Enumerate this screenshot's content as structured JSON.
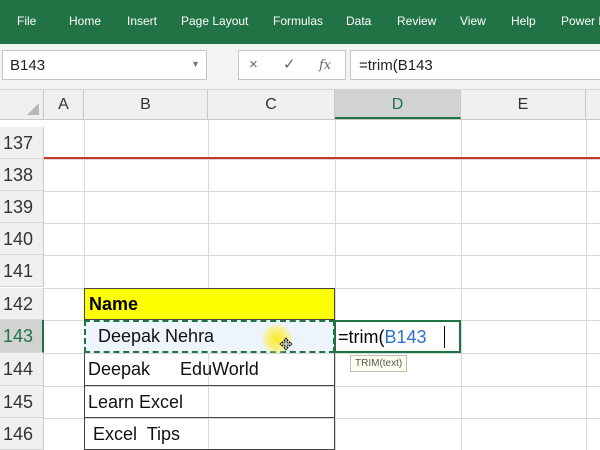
{
  "ribbon": {
    "tabs": [
      "File",
      "Home",
      "Insert",
      "Page Layout",
      "Formulas",
      "Data",
      "Review",
      "View",
      "Help",
      "Power P"
    ]
  },
  "formula_bar": {
    "name_box": "B143",
    "cancel_symbol": "×",
    "enter_symbol": "✓",
    "fx_symbol": "fx",
    "formula": "=trim(B143"
  },
  "columns": [
    "A",
    "B",
    "C",
    "D",
    "E"
  ],
  "active_column": "D",
  "rows": [
    "137",
    "138",
    "139",
    "140",
    "141",
    "142",
    "143",
    "144",
    "145",
    "146"
  ],
  "active_row": "143",
  "table": {
    "header": "Name",
    "rows": [
      "  Deepak Nehra",
      "Deepak      EduWorld",
      "Learn Excel",
      " Excel  Tips"
    ]
  },
  "edit": {
    "prefix": "=trim(",
    "reference": "B143",
    "tooltip": "TRIM(text)"
  },
  "colors": {
    "ribbon": "#217346",
    "header_fill": "#ffff00",
    "reference": "#2f6fd1"
  }
}
